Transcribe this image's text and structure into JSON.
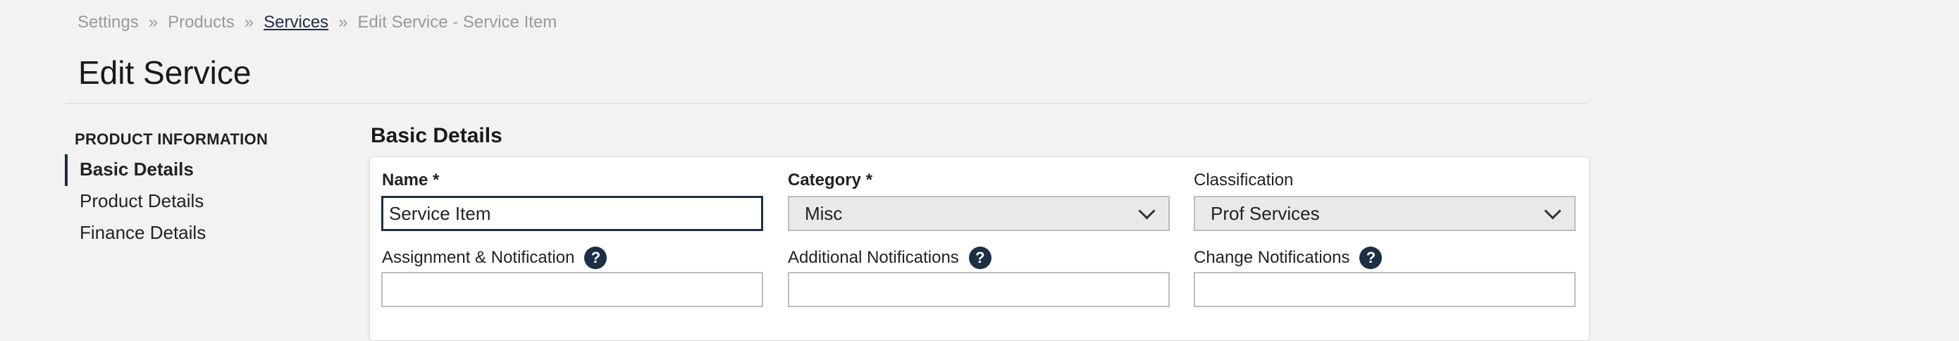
{
  "breadcrumb": {
    "items": [
      "Settings",
      "Products",
      "Services",
      "Edit Service - Service Item"
    ],
    "separator": "»"
  },
  "page": {
    "title": "Edit Service"
  },
  "sidebar": {
    "heading": "PRODUCT INFORMATION",
    "items": [
      {
        "label": "Basic Details",
        "active": true
      },
      {
        "label": "Product Details",
        "active": false
      },
      {
        "label": "Finance Details",
        "active": false
      }
    ]
  },
  "section": {
    "title": "Basic Details"
  },
  "form": {
    "name": {
      "label": "Name *",
      "value": "Service Item"
    },
    "category": {
      "label": "Category *",
      "value": "Misc"
    },
    "classification": {
      "label": "Classification",
      "value": "Prof Services"
    },
    "assignment": {
      "label": "Assignment & Notification",
      "value": ""
    },
    "additional": {
      "label": "Additional Notifications",
      "value": ""
    },
    "change": {
      "label": "Change Notifications",
      "value": ""
    },
    "help_glyph": "?"
  },
  "colors": {
    "accent": "#1b2f45",
    "background": "#f2f2f2"
  }
}
